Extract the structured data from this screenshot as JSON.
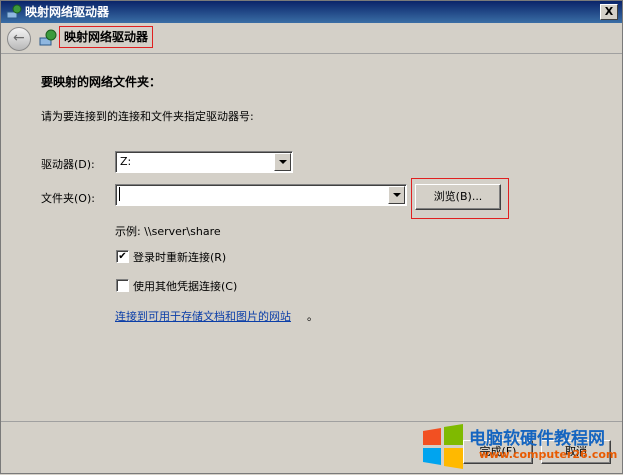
{
  "window": {
    "title": "映射网络驱动器",
    "close_label": "X"
  },
  "nav": {
    "title": "映射网络驱动器"
  },
  "main": {
    "heading": "要映射的网络文件夹：",
    "instruction": "请为要连接到的连接和文件夹指定驱动器号:",
    "drive_label": "驱动器(D):",
    "drive_value": "Z:",
    "folder_label": "文件夹(O):",
    "folder_value": "",
    "browse_label": "浏览(B)...",
    "example": "示例: \\\\server\\share",
    "reconnect_label": "登录时重新连接(R)",
    "reconnect_checked": "✔",
    "other_creds_label": "使用其他凭据连接(C)",
    "link_text": "连接到可用于存储文档和图片的网站",
    "link_tail": "。"
  },
  "footer": {
    "finish_label": "完成(F)",
    "cancel_label": "取消"
  },
  "watermark": {
    "title": "电脑软硬件教程网",
    "url": "www.computer26.com"
  },
  "colors": {
    "highlight": "#e02020",
    "link": "#0b3ea8",
    "title_bar": "#0a246a"
  }
}
